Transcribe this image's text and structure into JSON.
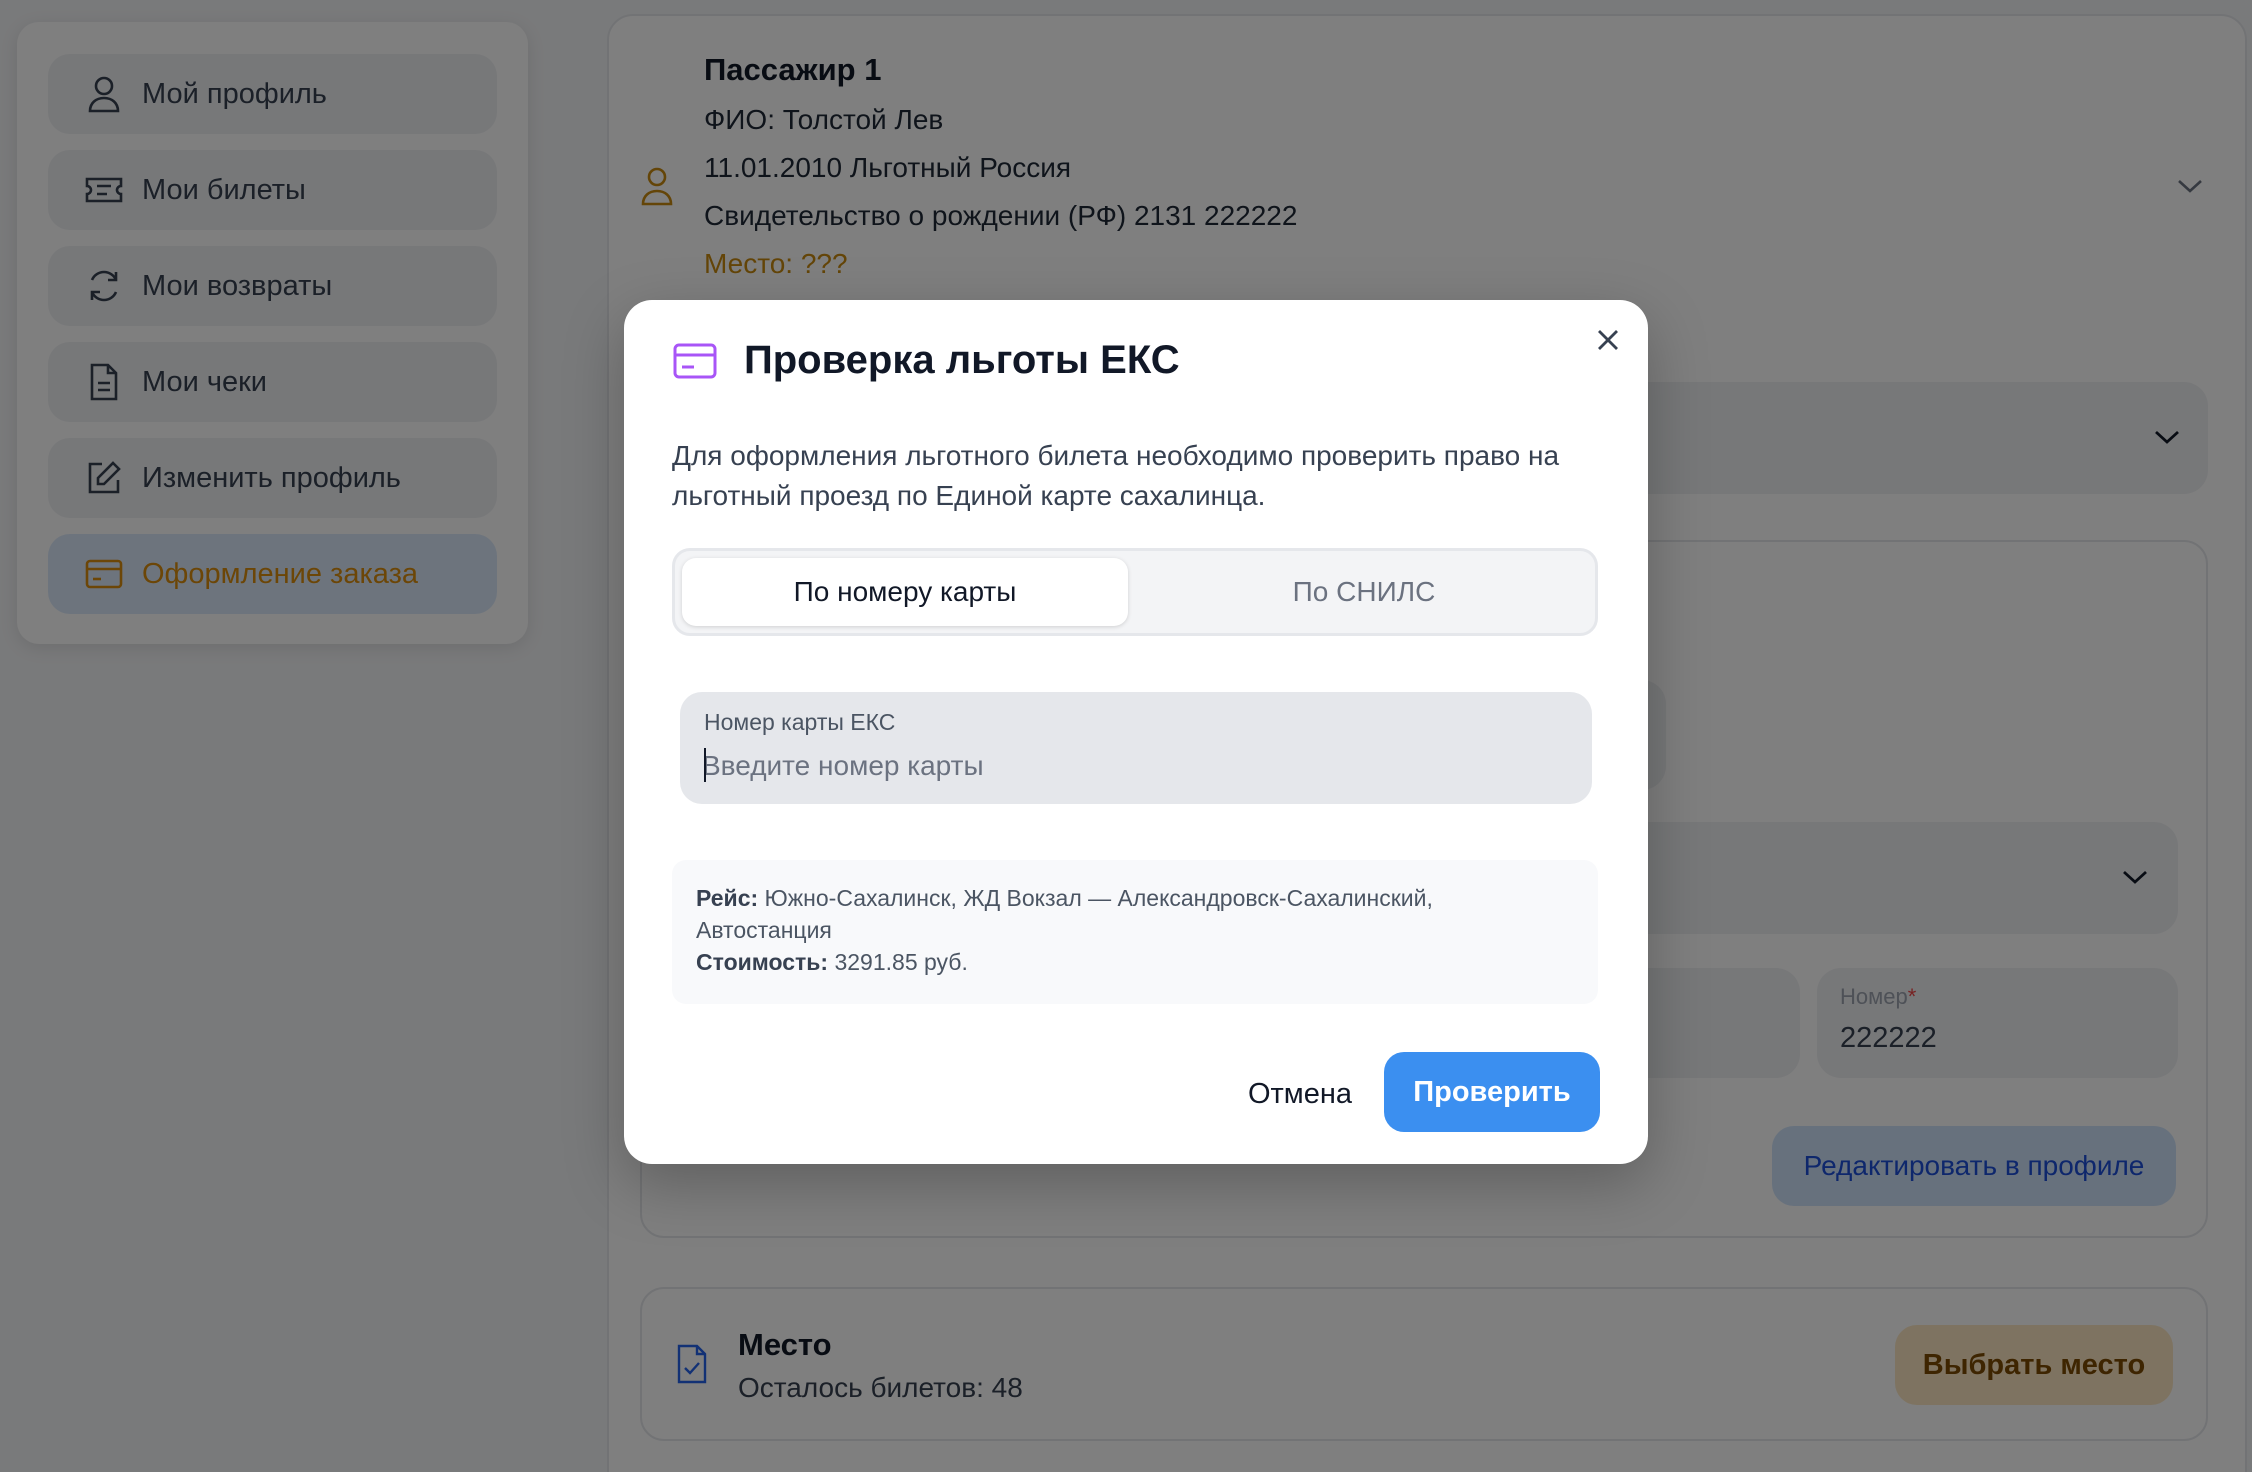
{
  "sidebar": {
    "items": [
      {
        "label": "Мой профиль",
        "icon": "user-icon"
      },
      {
        "label": "Мои билеты",
        "icon": "ticket-icon"
      },
      {
        "label": "Мои возвраты",
        "icon": "refresh-icon"
      },
      {
        "label": "Мои чеки",
        "icon": "receipt-icon"
      },
      {
        "label": "Изменить профиль",
        "icon": "edit-icon"
      },
      {
        "label": "Оформление заказа",
        "icon": "card-icon",
        "active": true
      }
    ]
  },
  "passenger": {
    "title": "Пассажир 1",
    "fio": "ФИО: Толстой Лев",
    "birth_category": "11.01.2010 Льготный Россия",
    "document": "Свидетельство о рождении (РФ) 2131 222222",
    "seat": "Место: ???"
  },
  "document_form": {
    "number_label": "Номер",
    "number_required_mark": "*",
    "number_value": "222222",
    "edit_profile_button": "Редактировать в профиле"
  },
  "seat_section": {
    "title": "Место",
    "remaining": "Осталось билетов: 48",
    "choose_button": "Выбрать место"
  },
  "modal": {
    "title": "Проверка льготы ЕКС",
    "description": "Для оформления льготного билета необходимо проверить право на льготный проезд по Единой карте сахалинца.",
    "tabs": [
      {
        "label": "По номеру карты",
        "active": true
      },
      {
        "label": "По СНИЛС",
        "active": false
      }
    ],
    "field": {
      "label": "Номер карты ЕКС",
      "placeholder": "Введите номер карты",
      "value": ""
    },
    "info": {
      "route_label": "Рейс:",
      "route_line1": "Южно-Сахалинск, ЖД Вокзал — Александровск-Сахалинский,",
      "route_line2": "Автостанция",
      "cost_label": "Стоимость:",
      "cost_value": "3291.85 руб."
    },
    "cancel_button": "Отмена",
    "submit_button": "Проверить"
  },
  "colors": {
    "accent": "#d98d0e",
    "primary_button": "#3b8ff0",
    "modal_icon": "#a855f7",
    "overlay": "rgba(0,0,0,0.5)"
  }
}
